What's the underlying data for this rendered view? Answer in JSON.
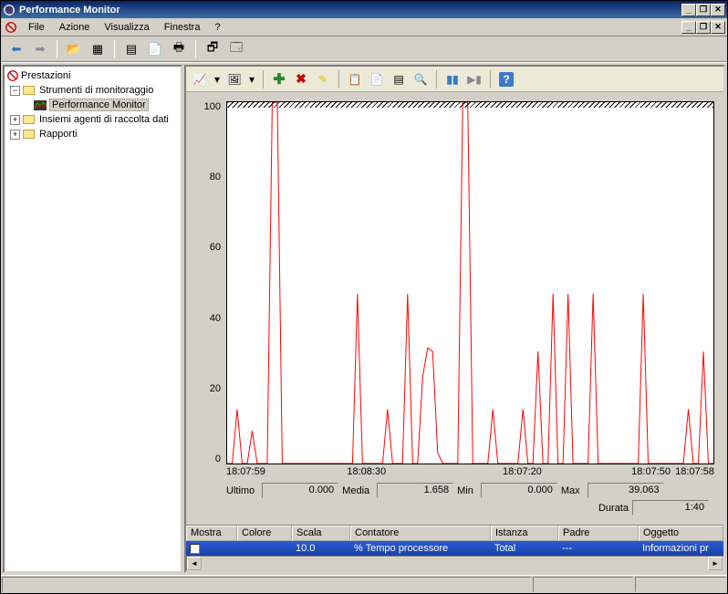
{
  "window": {
    "title": "Performance Monitor"
  },
  "menu": {
    "file": "File",
    "azione": "Azione",
    "visualizza": "Visualizza",
    "finestra": "Finestra",
    "help": "?"
  },
  "tree": {
    "root": "Prestazioni",
    "strumenti": "Strumenti di monitoraggio",
    "perfmon": "Performance Monitor",
    "insiemi": "Insiemi agenti di raccolta dati",
    "rapporti": "Rapporti"
  },
  "stats": {
    "ultimo_lbl": "Ultimo",
    "ultimo_val": "0.000",
    "media_lbl": "Media",
    "media_val": "1.658",
    "min_lbl": "Min",
    "min_val": "0.000",
    "max_lbl": "Max",
    "max_val": "39.063",
    "durata_lbl": "Durata",
    "durata_val": "1:40"
  },
  "legend_head": {
    "mostra": "Mostra",
    "colore": "Colore",
    "scala": "Scala",
    "contatore": "Contatore",
    "istanza": "Istanza",
    "padre": "Padre",
    "oggetto": "Oggetto"
  },
  "legend_row": {
    "scala": "10.0",
    "contatore": "% Tempo processore",
    "istanza": "Total",
    "padre": "---",
    "oggetto": "Informazioni pr"
  },
  "x_ticks": {
    "t0": "18:07:59",
    "t1": "18:08:30",
    "t2": "18:07:20",
    "t3": "18:07:50",
    "t4": "18:07:58"
  },
  "y_ticks": {
    "y100": "100",
    "y80": "80",
    "y60": "60",
    "y40": "40",
    "y20": "20",
    "y0": "0"
  },
  "chart_data": {
    "type": "line",
    "title": "",
    "xlabel": "",
    "ylabel": "",
    "ylim": [
      0,
      100
    ],
    "x_categories": [
      "18:07:59",
      "18:08:30",
      "18:07:20",
      "18:07:50",
      "18:07:58"
    ],
    "series": [
      {
        "name": "% Tempo processore",
        "color": "#ff0000",
        "values": [
          0,
          0,
          15,
          0,
          0,
          9,
          0,
          0,
          0,
          100,
          100,
          0,
          0,
          0,
          0,
          0,
          0,
          0,
          0,
          0,
          0,
          0,
          0,
          0,
          0,
          0,
          47,
          0,
          0,
          0,
          0,
          0,
          15,
          0,
          0,
          0,
          47,
          0,
          0,
          24,
          32,
          31,
          3,
          0,
          0,
          0,
          0,
          100,
          100,
          0,
          0,
          0,
          0,
          15,
          0,
          0,
          0,
          0,
          0,
          15,
          0,
          0,
          31,
          0,
          0,
          47,
          0,
          0,
          47,
          0,
          0,
          0,
          0,
          47,
          0,
          0,
          0,
          0,
          0,
          0,
          0,
          0,
          0,
          47,
          0,
          0,
          0,
          0,
          0,
          0,
          0,
          0,
          15,
          0,
          0,
          31,
          0,
          0
        ]
      }
    ]
  }
}
